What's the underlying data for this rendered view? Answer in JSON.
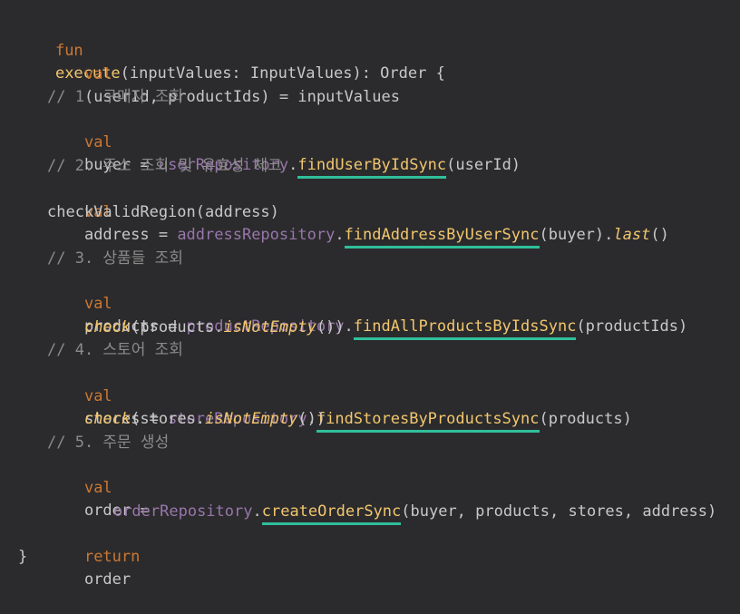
{
  "code": {
    "l1": {
      "kw": "fun",
      "fn": "execute",
      "p1": "(inputValues: InputValues): Order {"
    },
    "l2": {
      "kw": "val",
      "rest": "(userId, productIds) = inputValues"
    },
    "c1": "// 1. 구매자 조회",
    "l4": {
      "kw": "val",
      "pre": "buyer = ",
      "repo": "userRepository",
      "dot": ".",
      "call": "findUserByIdSync",
      "args": "(userId)"
    },
    "c2": "// 2. 주소 조회 및 유효성 체크",
    "l6": {
      "kw": "val",
      "pre": "address = ",
      "repo": "addressRepository",
      "dot": ".",
      "call": "findAddressByUserSync",
      "args": "(buyer).",
      "tail": "last",
      "end": "()"
    },
    "l7": "checkValidRegion(address)",
    "c3": "// 3. 상품들 조회",
    "l9": {
      "kw": "val",
      "pre": "products = ",
      "repo": "productRepository",
      "dot": ".",
      "call": "findAllProductsByIdsSync",
      "args": "(productIds)"
    },
    "l10": {
      "fn": "check",
      "mid": "(products.",
      "fn2": "isNotEmpty",
      "end": "())"
    },
    "c4": "// 4. 스토어 조회",
    "l12": {
      "kw": "val",
      "pre": "stores = ",
      "repo": "storeRepository",
      "dot": ".",
      "call": "findStoresByProductsSync",
      "args": "(products)"
    },
    "l13": {
      "fn": "check",
      "mid": "(stores.",
      "fn2": "isNotEmpty",
      "end": "())"
    },
    "c5": "// 5. 주문 생성",
    "l15": {
      "kw": "val",
      "rest": "order ="
    },
    "l16": {
      "repo": "orderRepository",
      "dot": ".",
      "call": "createOrderSync",
      "args": "(buyer, products, stores, address)"
    },
    "l18": {
      "kw": "return",
      "rest": "order"
    },
    "l19": "}"
  },
  "colors": {
    "background": "#2b2b2d",
    "keyword": "#cc7832",
    "function": "#f2c66d",
    "property": "#9876aa",
    "comment": "#8b8b8b",
    "underline": "#2fbf9b"
  }
}
